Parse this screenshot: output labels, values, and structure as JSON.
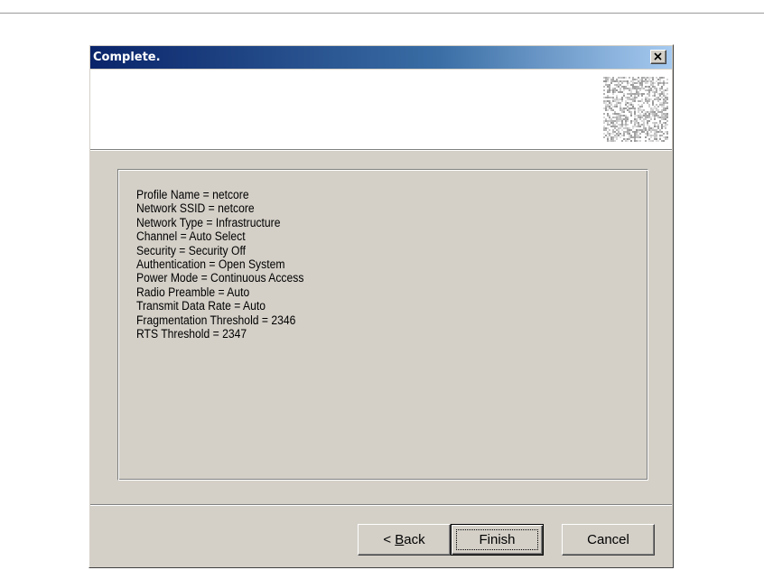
{
  "dialog": {
    "title": "Complete.",
    "close_icon": "close-x-icon",
    "header_graphic": "wizard-noise-graphic"
  },
  "summary": {
    "lines": [
      "Profile Name = netcore",
      "Network SSID = netcore",
      "Network Type = Infrastructure",
      "Channel = Auto Select",
      "Security = Security Off",
      "Authentication = Open System",
      "Power Mode = Continuous Access",
      "Radio Preamble = Auto",
      "Transmit Data Rate = Auto",
      "Fragmentation Threshold = 2346",
      "RTS Threshold = 2347"
    ]
  },
  "buttons": {
    "back_prefix": "< ",
    "back_mnemonic": "B",
    "back_rest": "ack",
    "finish": "Finish",
    "cancel": "Cancel"
  },
  "colors": {
    "titlebar_start": "#0a246a",
    "titlebar_end": "#a6caf0",
    "dialog_face": "#d4d0c8"
  }
}
